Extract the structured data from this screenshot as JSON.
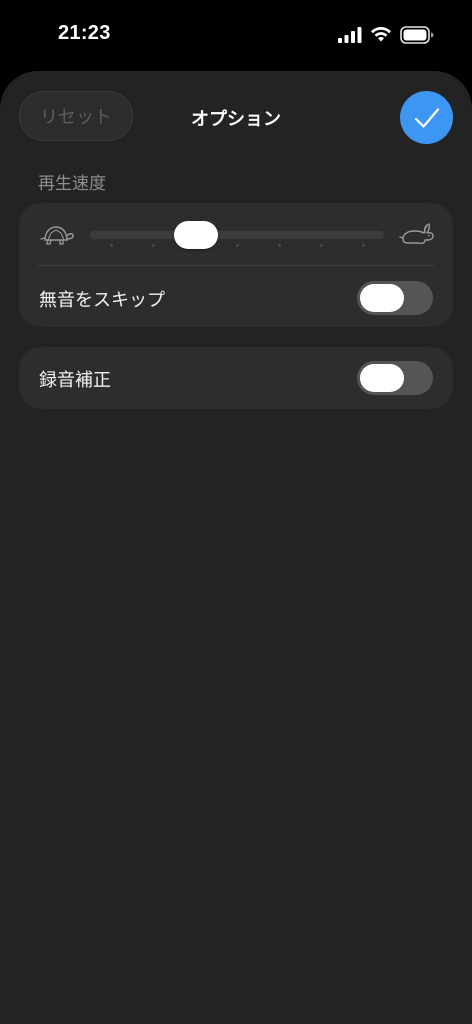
{
  "status_bar": {
    "time": "21:23",
    "icons": [
      "signal-icon",
      "wifi-icon",
      "battery-icon"
    ]
  },
  "header": {
    "reset_label": "リセット",
    "title": "オプション",
    "confirm_icon": "checkmark-icon"
  },
  "playback_speed": {
    "section_label": "再生速度",
    "slow_icon": "turtle-icon",
    "fast_icon": "rabbit-icon",
    "slider_position": 0.36,
    "tick_count": 7
  },
  "skip_silence": {
    "label": "無音をスキップ",
    "enabled": false
  },
  "enhance_recording": {
    "label": "録音補正",
    "enabled": false
  },
  "colors": {
    "accent": "#3d96f2",
    "sheet_background": "#232323",
    "card_background": "#2d2d2d",
    "toggle_off": "#555555"
  }
}
